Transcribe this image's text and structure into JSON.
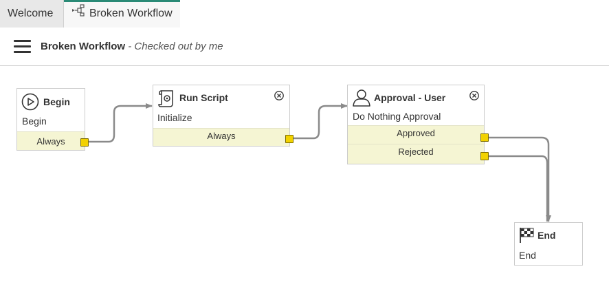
{
  "tabs": [
    {
      "label": "Welcome",
      "active": false
    },
    {
      "label": "Broken Workflow",
      "active": true,
      "icon": "workflow-icon"
    }
  ],
  "header": {
    "title": "Broken Workflow",
    "subtitle": " - Checked out by me",
    "menu_icon": "hamburger-menu-icon"
  },
  "nodes": {
    "begin": {
      "title": "Begin",
      "subtitle": "Begin",
      "icon": "play-circle-icon",
      "ports": [
        "Always"
      ]
    },
    "run_script": {
      "title": "Run Script",
      "subtitle": "Initialize",
      "icon": "script-scroll-icon",
      "ports": [
        "Always"
      ]
    },
    "approval": {
      "title": "Approval - User",
      "subtitle": "Do Nothing Approval",
      "icon": "user-icon",
      "ports": [
        "Approved",
        "Rejected"
      ]
    },
    "end": {
      "title": "End",
      "subtitle": "End",
      "icon": "checkered-flag-icon"
    }
  },
  "colors": {
    "accent": "#2a8a76",
    "port_row": "#f5f5d3",
    "port": "#f2d200",
    "wire": "#8a8a8a"
  }
}
